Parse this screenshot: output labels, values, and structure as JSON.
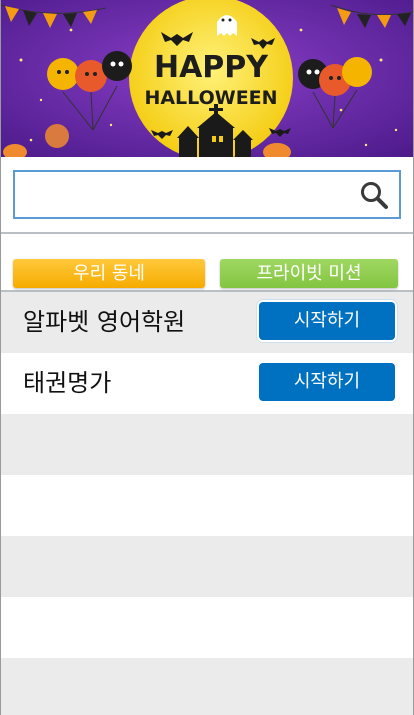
{
  "banner": {
    "line1": "HAPPY",
    "line2": "HALLOWEEN"
  },
  "search": {
    "value": "",
    "placeholder": ""
  },
  "tabs": [
    {
      "label": "우리 동네",
      "color": "#f8b31a"
    },
    {
      "label": "프라이빗 미션",
      "color": "#92d050"
    }
  ],
  "list": {
    "rows": [
      {
        "title": "알파벳 영어학원",
        "button": "시작하기"
      },
      {
        "title": "태권명가",
        "button": "시작하기"
      },
      {
        "title": "",
        "button": ""
      },
      {
        "title": "",
        "button": ""
      },
      {
        "title": "",
        "button": ""
      },
      {
        "title": "",
        "button": ""
      },
      {
        "title": "",
        "button": ""
      }
    ]
  },
  "colors": {
    "accent": "#0070c0",
    "search_border": "#5b9bd5",
    "row_stripe": "#ebebeb"
  }
}
